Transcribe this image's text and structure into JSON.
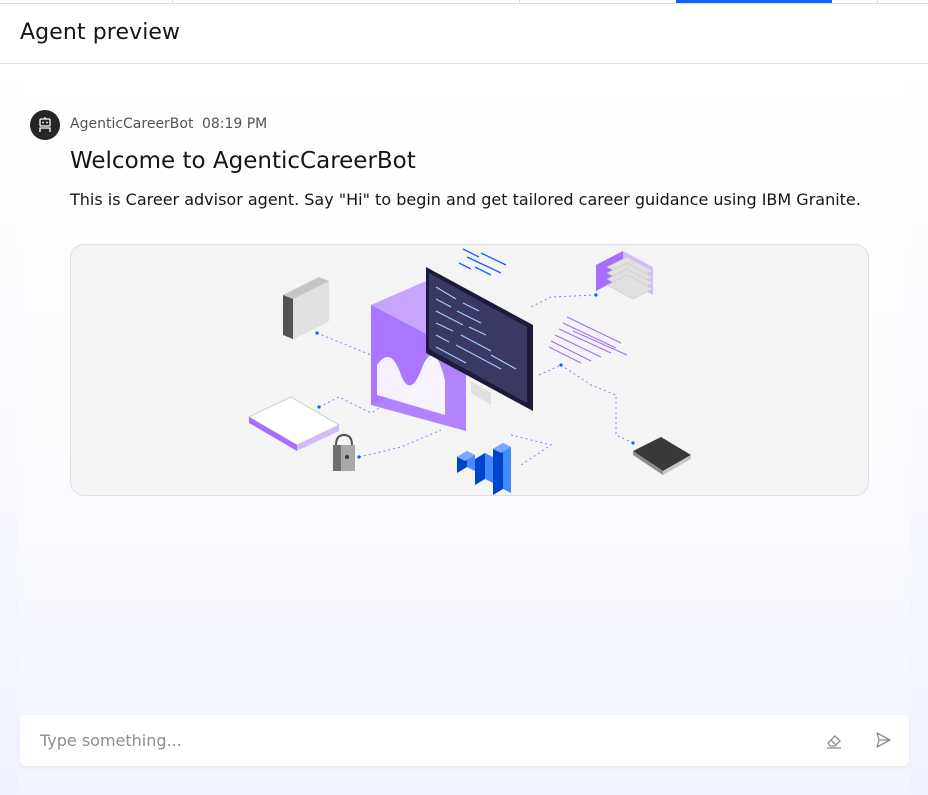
{
  "header": {
    "title": "Agent preview"
  },
  "message": {
    "author": "AgenticCareerBot",
    "time": "08:19 PM",
    "title": "Welcome to AgenticCareerBot",
    "body": "This is Career advisor agent. Say \"Hi\" to begin and get tailored career guidance using IBM Granite."
  },
  "composer": {
    "placeholder": "Type something...",
    "clear_icon": "eraser-icon",
    "send_icon": "send-icon"
  },
  "colors": {
    "accent": "#0f62fe",
    "purple": "#a56eff",
    "dark": "#262626"
  }
}
